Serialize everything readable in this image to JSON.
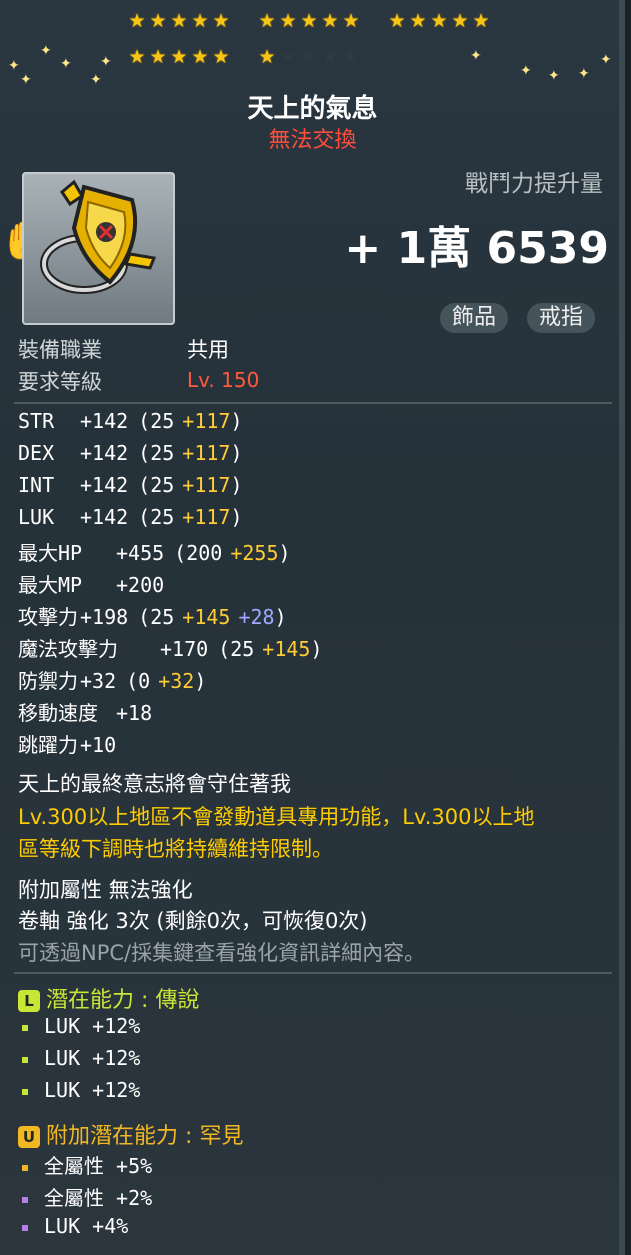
{
  "stars": {
    "total": 25,
    "filled": 21
  },
  "item": {
    "name": "天上的氣息",
    "trade_status": "無法交換",
    "power_label": "戰鬥力提升量",
    "power_value": "+ 1萬 6539",
    "tags": [
      "飾品",
      "戒指"
    ],
    "job_label": "裝備職業",
    "job_value": "共用",
    "level_label": "要求等級",
    "level_value": "Lv. 150"
  },
  "stats": [
    {
      "name": "STR",
      "value": "+142",
      "base": "(25",
      "bonus": "+117",
      "extra": "",
      "close": ")"
    },
    {
      "name": "DEX",
      "value": "+142",
      "base": "(25",
      "bonus": "+117",
      "extra": "",
      "close": ")"
    },
    {
      "name": "INT",
      "value": "+142",
      "base": "(25",
      "bonus": "+117",
      "extra": "",
      "close": ")"
    },
    {
      "name": "LUK",
      "value": "+142",
      "base": "(25",
      "bonus": "+117",
      "extra": "",
      "close": ")"
    },
    {
      "name": "最大HP",
      "value": "+455",
      "base": "(200",
      "bonus": "+255",
      "extra": "",
      "close": ")"
    },
    {
      "name": "最大MP",
      "value": "+200",
      "base": "",
      "bonus": "",
      "extra": "",
      "close": ""
    },
    {
      "name": "攻擊力",
      "value": "+198",
      "base": "(25",
      "bonus": "+145",
      "extra": "+28",
      "close": ")"
    },
    {
      "name": "魔法攻擊力",
      "value": "+170",
      "base": "(25",
      "bonus": "+145",
      "extra": "",
      "close": ")"
    },
    {
      "name": "防禦力",
      "value": "+32",
      "base": "(0",
      "bonus": "+32",
      "extra": "",
      "close": ")"
    },
    {
      "name": "移動速度",
      "value": "+18",
      "base": "",
      "bonus": "",
      "extra": "",
      "close": ""
    },
    {
      "name": "跳躍力",
      "value": "+10",
      "base": "",
      "bonus": "",
      "extra": "",
      "close": ""
    }
  ],
  "description": {
    "flavor": "天上的最終意志將會守住著我",
    "restriction_1": "Lv.300以上地區不會發動道具專用功能，Lv.300以上地",
    "restriction_2": "區等級下調時也將持續維持限制。"
  },
  "enhance": {
    "line1": "附加屬性 無法強化",
    "line2": "卷軸 強化 3次 (剩餘0次，可恢復0次)",
    "line3": "可透過NPC/採集鍵查看強化資訊詳細內容。"
  },
  "potential": {
    "badge": "L",
    "title": "潛在能力",
    "sep": ":",
    "grade": "傳說",
    "color": "#c8e636",
    "lines": [
      "LUK +12%",
      "LUK +12%",
      "LUK +12%"
    ]
  },
  "bonus_potential": {
    "badge": "U",
    "title": "附加潛在能力",
    "sep": ":",
    "grade": "罕見",
    "color": "#f2b823",
    "lines": [
      {
        "text": "全屬性 +5%",
        "color": "#f2b823"
      },
      {
        "text": "全屬性 +2%",
        "color": "#b57ee8"
      },
      {
        "text": "LUK +4%",
        "color": "#b57ee8"
      }
    ]
  }
}
